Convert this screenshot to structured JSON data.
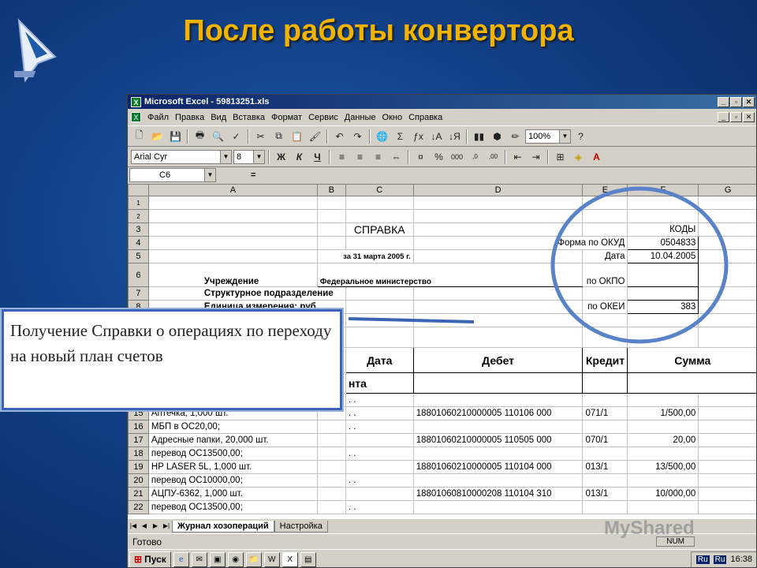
{
  "slide": {
    "title": "После работы конвертора"
  },
  "window": {
    "title": "Microsoft Excel - 59813251.xls"
  },
  "menu": [
    "Файл",
    "Правка",
    "Вид",
    "Вставка",
    "Формат",
    "Сервис",
    "Данные",
    "Окно",
    "Справка"
  ],
  "toolbar": {
    "zoom": "100%",
    "font": "Arial Cyr",
    "size": "8"
  },
  "formula": {
    "namebox": "C6",
    "eq": "="
  },
  "columns": [
    "A",
    "B",
    "C",
    "D",
    "E",
    "F",
    "G"
  ],
  "sheet": {
    "row3": {
      "c": "СПРАВКА",
      "f": "КОДЫ"
    },
    "row4": {
      "e": "Форма по ОКУД",
      "f": "0504833"
    },
    "row5": {
      "c": "за 31 марта 2005 г.",
      "e": "Дата",
      "f": "10.04.2005"
    },
    "row6": {
      "a": "Учреждение",
      "b": "Федеральное министерство",
      "e": "по ОКПО"
    },
    "row7": {
      "a": "Структурное подразделение"
    },
    "row8": {
      "a": "Единица измерения: руб.",
      "e": "по ОКЕИ",
      "f": "383"
    },
    "headers": {
      "date": "Дата",
      "debit": "Дебет",
      "credit": "Кредит",
      "sum": "Сумма",
      "tail": "нта"
    },
    "rows": [
      {
        "n": "15",
        "a": "Аптечка, 1,000 шт.",
        "c": ". .",
        "d": "18801060210000005 110106 000",
        "e": "071/1",
        "f": "1/500,00"
      },
      {
        "n": "16",
        "a": "МБП в ОС20,00;",
        "c": ". .",
        "d": "",
        "e": "",
        "f": ""
      },
      {
        "n": "17",
        "a": "Адресные папки, 20,000 шт.",
        "c": "",
        "d": "18801060210000005 110505 000",
        "e": "070/1",
        "f": "20,00"
      },
      {
        "n": "18",
        "a": "перевод ОС13500,00;",
        "c": ". .",
        "d": "",
        "e": "",
        "f": ""
      },
      {
        "n": "19",
        "a": "HP LASER 5L, 1,000 шт.",
        "c": "",
        "d": "18801060210000005 110104 000",
        "e": "013/1",
        "f": "13/500,00"
      },
      {
        "n": "20",
        "a": "перевод ОС10000,00;",
        "c": ". .",
        "d": "",
        "e": "",
        "f": ""
      },
      {
        "n": "21",
        "a": "АЦПУ-6362, 1,000 шт.",
        "c": "",
        "d": "18801060810000208 110104 310",
        "e": "013/1",
        "f": "10/000,00"
      },
      {
        "n": "22",
        "a": "перевод ОС13500,00;",
        "c": ". .",
        "d": "",
        "e": "",
        "f": ""
      }
    ]
  },
  "tabs": {
    "active": "Журнал хозопераций",
    "other": "Настройка"
  },
  "status": {
    "ready": "Готово",
    "num": "NUM"
  },
  "taskbar": {
    "start": "Пуск",
    "lang1": "Ru",
    "lang2": "Ru",
    "time": "16:38"
  },
  "callout": {
    "text": "Получение Справки о операциях по переходу на новый план счетов"
  },
  "watermark": "MyShared",
  "colors": {
    "title": "#f0b400",
    "callout_border": "#3c64b4",
    "circle": "#5a82c8"
  }
}
